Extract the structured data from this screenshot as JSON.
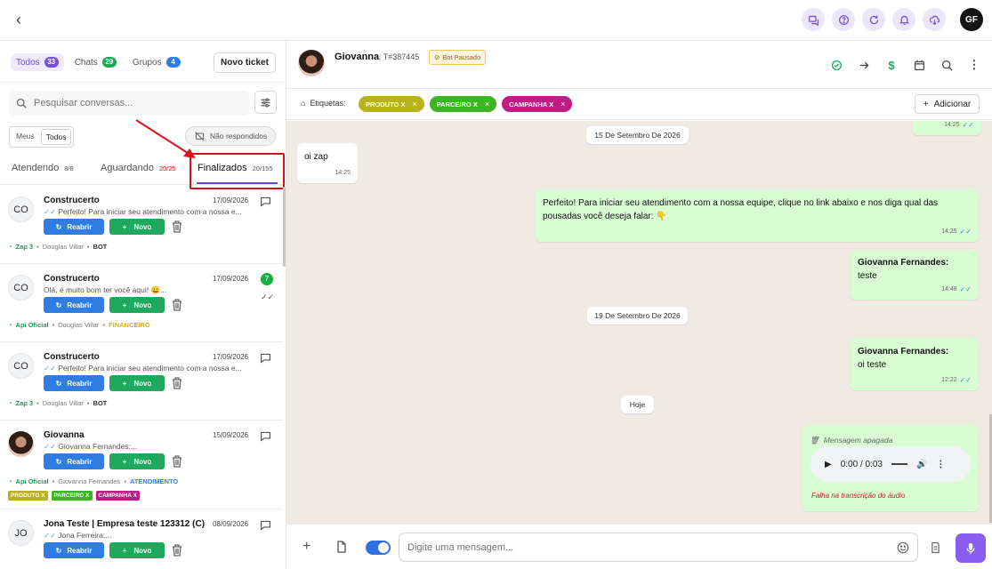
{
  "topbar": {
    "user_initials": "GF",
    "icons": [
      "chat-bubbles-icon",
      "help-icon",
      "refresh-icon",
      "bell-icon",
      "cloud-download-icon"
    ]
  },
  "left": {
    "filters": [
      {
        "label": "Todos",
        "count": "33",
        "color": "#7a4fe0"
      },
      {
        "label": "Chats",
        "count": "29",
        "color": "#18a957"
      },
      {
        "label": "Grupos",
        "count": "4",
        "color": "#2f7de1"
      }
    ],
    "new_ticket": "Novo ticket",
    "search_placeholder": "Pesquisar conversas...",
    "seg": [
      "Meus",
      "Todos"
    ],
    "nao_respondidos": "Não respondidos",
    "status_tabs": [
      {
        "label": "Atendendo",
        "count": "8/8"
      },
      {
        "label": "Aguardando",
        "count": "20/25"
      },
      {
        "label": "Finalizados",
        "count": "20/155"
      }
    ],
    "btn_reabrir": "Reabrir",
    "btn_novo": "Novo",
    "items": [
      {
        "initials": "CO",
        "name": "Construcerto",
        "date": "17/09/2026",
        "preview": "Perfeito! Para iniciar seu atendimento com a nossa e...",
        "source": "Zap 3",
        "agent": "Douglas Villar",
        "queue": "BOT"
      },
      {
        "initials": "CO",
        "name": "Construcerto",
        "date": "17/09/2026",
        "preview": "Olá, é muito bom ter você aqui! 😀...",
        "source": "Api Oficial",
        "agent": "Douglas Villar",
        "queue": "FINANCEIRO",
        "unread": "7"
      },
      {
        "initials": "CO",
        "name": "Construcerto",
        "date": "17/09/2026",
        "preview": "Perfeito! Para iniciar seu atendimento com a nossa e...",
        "source": "Zap 3",
        "agent": "Douglas Villar",
        "queue": "BOT"
      },
      {
        "initials": "",
        "name": "Giovanna",
        "date": "15/09/2026",
        "preview": "Giovanna Fernandes:...",
        "source": "Api Oficial",
        "agent": "Giovanna Fernandes",
        "queue": "ATENDIMENTO",
        "tags": [
          "PRODUTO X",
          "PARCEIRO X",
          "CAMPANHA X"
        ]
      },
      {
        "initials": "JO",
        "name": "Jona Teste | Empresa teste 123312 (C)",
        "date": "08/09/2026",
        "preview": "Jona Ferreira:..."
      }
    ]
  },
  "chat": {
    "contact_name": "Giovanna",
    "ticket": "T#387445",
    "bot_status": "Bot Pausado",
    "labels_title": "Etiquetas:",
    "tags": [
      {
        "label": "PRODUTO X",
        "color": "#b9b21f"
      },
      {
        "label": "PARCEIRO X",
        "color": "#3cb521"
      },
      {
        "label": "CAMPANHA X",
        "color": "#c01c83"
      }
    ],
    "add_label": "Adicionar",
    "messages": {
      "top_time": "14:25",
      "date1": "15 De Setembro De 2026",
      "m1_text": "oi zap",
      "m1_time": "14:25",
      "m2_text": "Perfeito! Para iniciar seu atendimento com a nossa equipe, clique no link abaixo e nos diga qual das pousadas você deseja falar: 👇",
      "m2_time": "14:25",
      "m3_author": "Giovanna Fernandes:",
      "m3_text": "teste",
      "m3_time": "14:48",
      "date2": "19 De Setembro De 2026",
      "m4_author": "Giovanna Fernandes:",
      "m4_text": "oi teste",
      "m4_time": "12:22",
      "date3": "Hoje",
      "deleted": "Mensagem apagada",
      "audio_time": "0:00 / 0:03",
      "audio_fail": "Falha na transcrição do áudio"
    },
    "composer_placeholder": "Digite uma mensagem..."
  }
}
